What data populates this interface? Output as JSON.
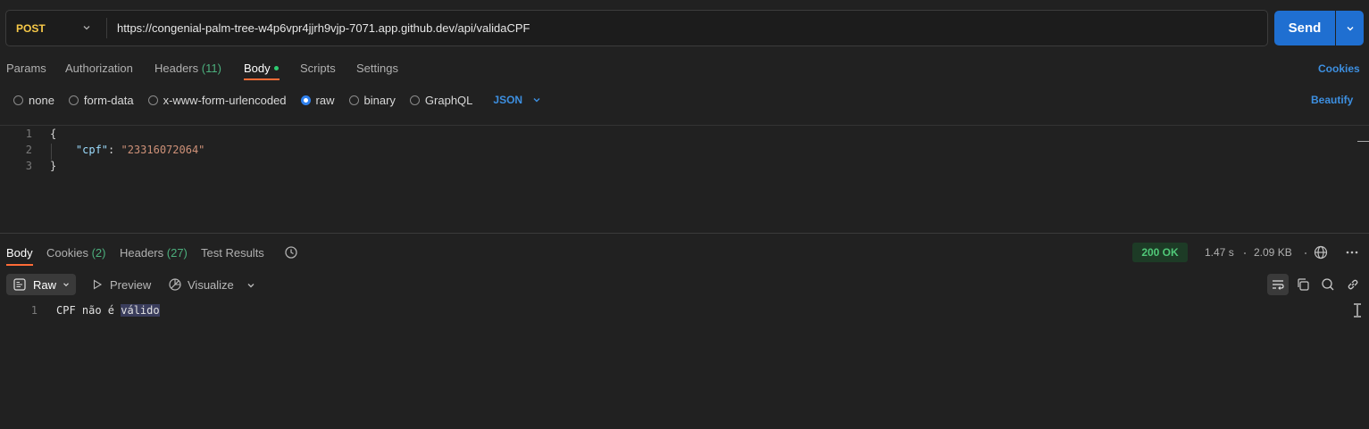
{
  "request": {
    "method": "POST",
    "url": "https://congenial-palm-tree-w4p6vpr4jjrh9vjp-7071.app.github.dev/api/validaCPF",
    "send_label": "Send"
  },
  "request_tabs": {
    "params": "Params",
    "authorization": "Authorization",
    "headers": "Headers",
    "headers_count": "(11)",
    "body": "Body",
    "scripts": "Scripts",
    "settings": "Settings",
    "cookies": "Cookies"
  },
  "body_types": {
    "none": "none",
    "form_data": "form-data",
    "urlencoded": "x-www-form-urlencoded",
    "raw": "raw",
    "binary": "binary",
    "graphql": "GraphQL",
    "format": "JSON",
    "beautify": "Beautify",
    "selected": "raw"
  },
  "editor": {
    "line_numbers": [
      "1",
      "2",
      "3"
    ],
    "open_brace": "{",
    "indent": "    ",
    "key": "\"cpf\"",
    "colon": ": ",
    "value": "\"23316072064\"",
    "close_brace": "}"
  },
  "response_tabs": {
    "body": "Body",
    "cookies": "Cookies",
    "cookies_count": "(2)",
    "headers": "Headers",
    "headers_count": "(27)",
    "test_results": "Test Results"
  },
  "response_meta": {
    "status": "200 OK",
    "time": "1.47 s",
    "size": "2.09 KB"
  },
  "response_toolbar": {
    "raw": "Raw",
    "preview": "Preview",
    "visualize": "Visualize"
  },
  "response_body": {
    "line_number": "1",
    "text_plain": "CPF não é ",
    "text_highlight": "válido"
  },
  "colors": {
    "accent": "#ff6c37",
    "send": "#1f6fd1",
    "method": "#f7c948",
    "status_ok": "#50c878",
    "link": "#3d8fe0"
  },
  "icons": [
    "chevron-down-icon",
    "history-icon",
    "globe-icon",
    "more-icon",
    "play-icon",
    "visualize-icon",
    "wrap-icon",
    "copy-icon",
    "search-icon",
    "link-icon",
    "raw-icon"
  ]
}
